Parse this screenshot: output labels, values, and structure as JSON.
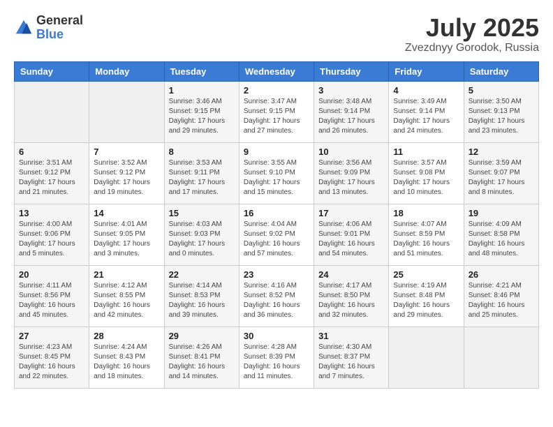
{
  "header": {
    "logo_general": "General",
    "logo_blue": "Blue",
    "month_title": "July 2025",
    "location": "Zvezdnyy Gorodok, Russia"
  },
  "days_of_week": [
    "Sunday",
    "Monday",
    "Tuesday",
    "Wednesday",
    "Thursday",
    "Friday",
    "Saturday"
  ],
  "weeks": [
    [
      {
        "day": "",
        "info": ""
      },
      {
        "day": "",
        "info": ""
      },
      {
        "day": "1",
        "info": "Sunrise: 3:46 AM\nSunset: 9:15 PM\nDaylight: 17 hours and 29 minutes."
      },
      {
        "day": "2",
        "info": "Sunrise: 3:47 AM\nSunset: 9:15 PM\nDaylight: 17 hours and 27 minutes."
      },
      {
        "day": "3",
        "info": "Sunrise: 3:48 AM\nSunset: 9:14 PM\nDaylight: 17 hours and 26 minutes."
      },
      {
        "day": "4",
        "info": "Sunrise: 3:49 AM\nSunset: 9:14 PM\nDaylight: 17 hours and 24 minutes."
      },
      {
        "day": "5",
        "info": "Sunrise: 3:50 AM\nSunset: 9:13 PM\nDaylight: 17 hours and 23 minutes."
      }
    ],
    [
      {
        "day": "6",
        "info": "Sunrise: 3:51 AM\nSunset: 9:12 PM\nDaylight: 17 hours and 21 minutes."
      },
      {
        "day": "7",
        "info": "Sunrise: 3:52 AM\nSunset: 9:12 PM\nDaylight: 17 hours and 19 minutes."
      },
      {
        "day": "8",
        "info": "Sunrise: 3:53 AM\nSunset: 9:11 PM\nDaylight: 17 hours and 17 minutes."
      },
      {
        "day": "9",
        "info": "Sunrise: 3:55 AM\nSunset: 9:10 PM\nDaylight: 17 hours and 15 minutes."
      },
      {
        "day": "10",
        "info": "Sunrise: 3:56 AM\nSunset: 9:09 PM\nDaylight: 17 hours and 13 minutes."
      },
      {
        "day": "11",
        "info": "Sunrise: 3:57 AM\nSunset: 9:08 PM\nDaylight: 17 hours and 10 minutes."
      },
      {
        "day": "12",
        "info": "Sunrise: 3:59 AM\nSunset: 9:07 PM\nDaylight: 17 hours and 8 minutes."
      }
    ],
    [
      {
        "day": "13",
        "info": "Sunrise: 4:00 AM\nSunset: 9:06 PM\nDaylight: 17 hours and 5 minutes."
      },
      {
        "day": "14",
        "info": "Sunrise: 4:01 AM\nSunset: 9:05 PM\nDaylight: 17 hours and 3 minutes."
      },
      {
        "day": "15",
        "info": "Sunrise: 4:03 AM\nSunset: 9:03 PM\nDaylight: 17 hours and 0 minutes."
      },
      {
        "day": "16",
        "info": "Sunrise: 4:04 AM\nSunset: 9:02 PM\nDaylight: 16 hours and 57 minutes."
      },
      {
        "day": "17",
        "info": "Sunrise: 4:06 AM\nSunset: 9:01 PM\nDaylight: 16 hours and 54 minutes."
      },
      {
        "day": "18",
        "info": "Sunrise: 4:07 AM\nSunset: 8:59 PM\nDaylight: 16 hours and 51 minutes."
      },
      {
        "day": "19",
        "info": "Sunrise: 4:09 AM\nSunset: 8:58 PM\nDaylight: 16 hours and 48 minutes."
      }
    ],
    [
      {
        "day": "20",
        "info": "Sunrise: 4:11 AM\nSunset: 8:56 PM\nDaylight: 16 hours and 45 minutes."
      },
      {
        "day": "21",
        "info": "Sunrise: 4:12 AM\nSunset: 8:55 PM\nDaylight: 16 hours and 42 minutes."
      },
      {
        "day": "22",
        "info": "Sunrise: 4:14 AM\nSunset: 8:53 PM\nDaylight: 16 hours and 39 minutes."
      },
      {
        "day": "23",
        "info": "Sunrise: 4:16 AM\nSunset: 8:52 PM\nDaylight: 16 hours and 36 minutes."
      },
      {
        "day": "24",
        "info": "Sunrise: 4:17 AM\nSunset: 8:50 PM\nDaylight: 16 hours and 32 minutes."
      },
      {
        "day": "25",
        "info": "Sunrise: 4:19 AM\nSunset: 8:48 PM\nDaylight: 16 hours and 29 minutes."
      },
      {
        "day": "26",
        "info": "Sunrise: 4:21 AM\nSunset: 8:46 PM\nDaylight: 16 hours and 25 minutes."
      }
    ],
    [
      {
        "day": "27",
        "info": "Sunrise: 4:23 AM\nSunset: 8:45 PM\nDaylight: 16 hours and 22 minutes."
      },
      {
        "day": "28",
        "info": "Sunrise: 4:24 AM\nSunset: 8:43 PM\nDaylight: 16 hours and 18 minutes."
      },
      {
        "day": "29",
        "info": "Sunrise: 4:26 AM\nSunset: 8:41 PM\nDaylight: 16 hours and 14 minutes."
      },
      {
        "day": "30",
        "info": "Sunrise: 4:28 AM\nSunset: 8:39 PM\nDaylight: 16 hours and 11 minutes."
      },
      {
        "day": "31",
        "info": "Sunrise: 4:30 AM\nSunset: 8:37 PM\nDaylight: 16 hours and 7 minutes."
      },
      {
        "day": "",
        "info": ""
      },
      {
        "day": "",
        "info": ""
      }
    ]
  ]
}
